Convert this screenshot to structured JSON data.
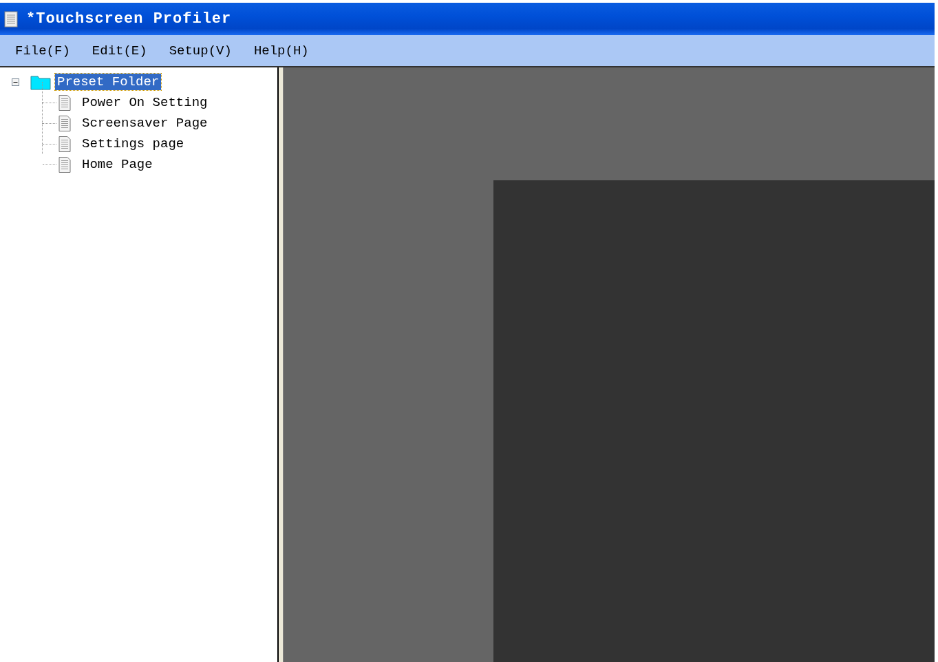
{
  "window": {
    "title": "*Touchscreen Profiler"
  },
  "menu": [
    "File(F)",
    "Edit(E)",
    "Setup(V)",
    "Help(H)"
  ],
  "tree": {
    "label": "Preset Folder",
    "expanded": true,
    "selected": true,
    "children": [
      {
        "label": "Power On Setting",
        "selected": false
      },
      {
        "label": "Screensaver Page",
        "selected": false
      },
      {
        "label": "Settings page",
        "selected": false
      },
      {
        "label": "Home Page",
        "selected": false
      }
    ]
  }
}
